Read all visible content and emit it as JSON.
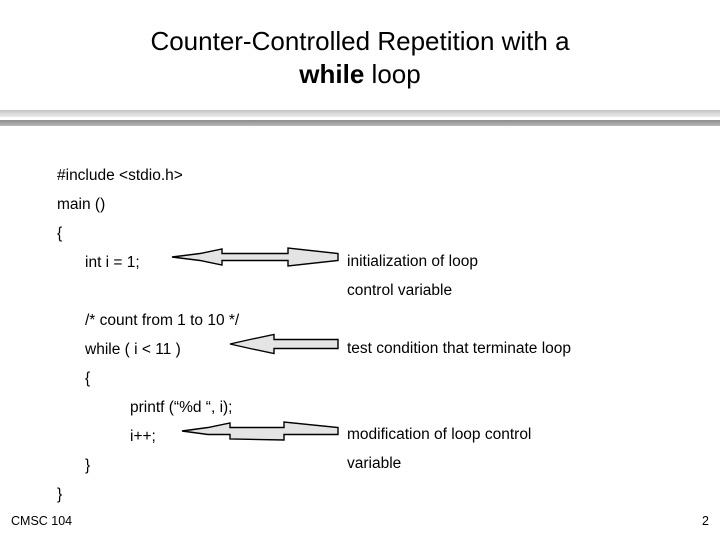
{
  "slide": {
    "title": {
      "line1": "Counter-Controlled Repetition with a",
      "line2_keyword": "while",
      "line2_rest": " loop"
    },
    "code": [
      {
        "indent": 0,
        "text": "#include <stdio.h>"
      },
      {
        "indent": 0,
        "text": "main ()"
      },
      {
        "indent": 0,
        "text": "{"
      },
      {
        "indent": 1,
        "text": "int i = 1;"
      },
      {
        "indent": 0,
        "text": ""
      },
      {
        "indent": 1,
        "text": "/* count from 1 to 10 */"
      },
      {
        "indent": 1,
        "text": "while ( i < 11 )"
      },
      {
        "indent": 1,
        "text": "{"
      },
      {
        "indent": 2,
        "text": "printf (“%d “, i);"
      },
      {
        "indent": 2,
        "text": "i++;"
      },
      {
        "indent": 1,
        "text": "}"
      },
      {
        "indent": 0,
        "text": "}"
      }
    ],
    "annotations": {
      "initialization": "initialization of loop\ncontrol variable",
      "test_condition": "test condition that terminate loop",
      "modification": "modification of loop control\nvariable"
    },
    "footer": {
      "course": "CMSC 104",
      "page_number": "2"
    },
    "colors": {
      "background": "#ffffff",
      "text": "#000000",
      "divider_light": "#d8d8d8",
      "divider_dark": "#a2a2a2",
      "arrow_fill": "#e4e4e4",
      "arrow_stroke": "#000000"
    }
  }
}
